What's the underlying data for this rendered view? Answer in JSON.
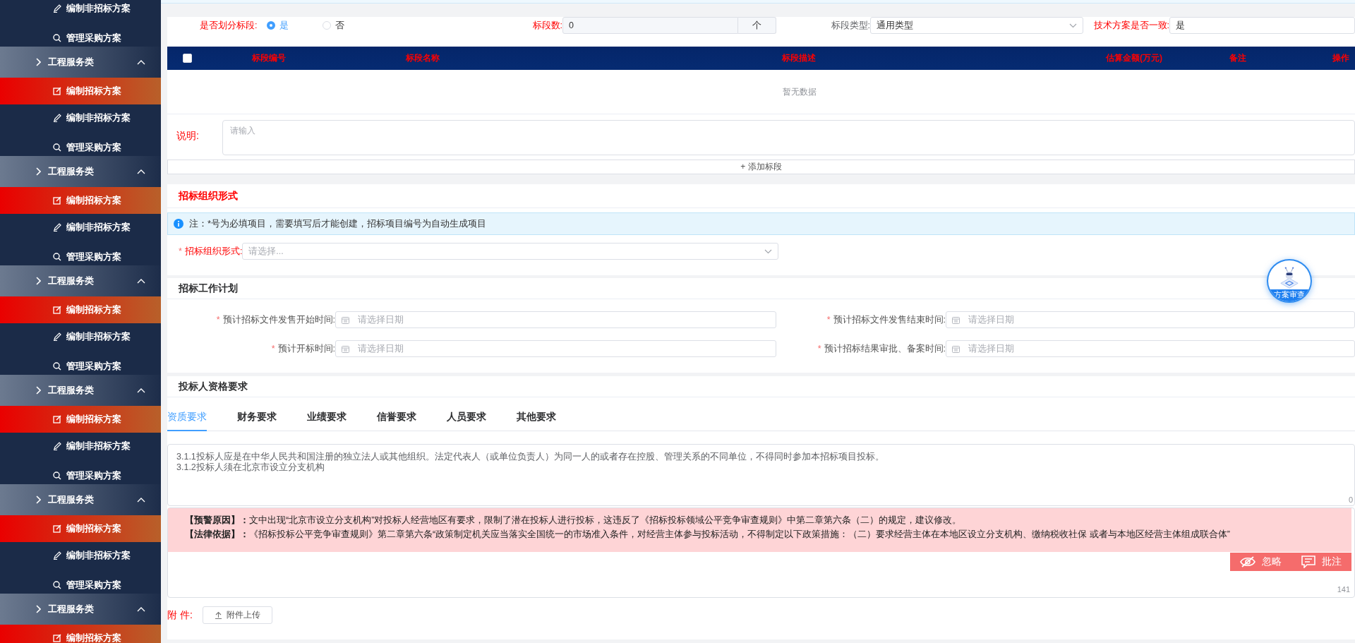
{
  "sidebar": {
    "items": [
      {
        "kind": "item",
        "label": "编制非招标方案",
        "selected": false
      },
      {
        "kind": "item",
        "label": "管理采购方案",
        "selected": false
      },
      {
        "kind": "group",
        "label": "工程服务类",
        "expanded": true
      },
      {
        "kind": "item",
        "label": "编制招标方案",
        "selected": true
      },
      {
        "kind": "item",
        "label": "编制非招标方案",
        "selected": false
      },
      {
        "kind": "item",
        "label": "管理采购方案",
        "selected": false
      },
      {
        "kind": "group",
        "label": "工程服务类",
        "expanded": true
      },
      {
        "kind": "item",
        "label": "编制招标方案",
        "selected": true
      },
      {
        "kind": "item",
        "label": "编制非招标方案",
        "selected": false
      },
      {
        "kind": "item",
        "label": "管理采购方案",
        "selected": false
      },
      {
        "kind": "group",
        "label": "工程服务类",
        "expanded": true
      },
      {
        "kind": "item",
        "label": "编制招标方案",
        "selected": true
      },
      {
        "kind": "item",
        "label": "编制非招标方案",
        "selected": false
      },
      {
        "kind": "item",
        "label": "管理采购方案",
        "selected": false
      },
      {
        "kind": "group",
        "label": "工程服务类",
        "expanded": true
      },
      {
        "kind": "item",
        "label": "编制招标方案",
        "selected": true
      },
      {
        "kind": "item",
        "label": "编制非招标方案",
        "selected": false
      },
      {
        "kind": "item",
        "label": "管理采购方案",
        "selected": false
      },
      {
        "kind": "group",
        "label": "工程服务类",
        "expanded": true
      },
      {
        "kind": "item",
        "label": "编制招标方案",
        "selected": true
      },
      {
        "kind": "item",
        "label": "编制非招标方案",
        "selected": false
      },
      {
        "kind": "item",
        "label": "管理采购方案",
        "selected": false
      },
      {
        "kind": "group",
        "label": "工程服务类",
        "expanded": true
      },
      {
        "kind": "item",
        "label": "编制招标方案",
        "selected": true
      }
    ]
  },
  "segment_form": {
    "fields": [
      {
        "kind": "radio",
        "label": "是否划分标段:",
        "required": true,
        "options": [
          {
            "label": "是",
            "selected": true
          },
          {
            "label": "否",
            "selected": false
          }
        ]
      },
      {
        "kind": "number",
        "label": "标段数:",
        "required": true,
        "value": "0",
        "unit": "个"
      },
      {
        "kind": "select",
        "label": "标段类型:",
        "required": false,
        "value": "通用类型"
      },
      {
        "kind": "text",
        "label": "技术方案是否一致:",
        "required": true,
        "value": "是"
      }
    ]
  },
  "table": {
    "select_all_checked": false,
    "columns": [
      "标段编号",
      "标段名称",
      "标段描述",
      "估算金额(万元)",
      "备注",
      "操作"
    ],
    "empty_text": "暂无数据"
  },
  "note": {
    "label": "说明:",
    "placeholder": "请输入"
  },
  "add_button": "+ 添加标段",
  "org_section": {
    "title": "招标组织形式",
    "alert": "注：*号为必填项目，需要填写后才能创建，招标项目编号为自动生成项目",
    "field": {
      "required_mark": "*",
      "label": "招标组织形式:",
      "placeholder": "请选择..."
    }
  },
  "plan_section": {
    "title": "招标工作计划",
    "fields": [
      {
        "required_mark": "*",
        "label": "预计招标文件发售开始时间:",
        "placeholder": "请选择日期"
      },
      {
        "required_mark": "*",
        "label": "预计招标文件发售结束时间:",
        "placeholder": "请选择日期"
      },
      {
        "required_mark": "*",
        "label": "预计开标时间:",
        "placeholder": "请选择日期"
      },
      {
        "required_mark": "*",
        "label": "预计招标结果审批、备案时间:",
        "placeholder": "请选择日期"
      }
    ]
  },
  "review_badge": {
    "label": "方案审查"
  },
  "qualification": {
    "title": "投标人资格要求",
    "tabs": [
      {
        "label": "资质要求",
        "selected": true
      },
      {
        "label": "财务要求",
        "selected": false
      },
      {
        "label": "业绩要求",
        "selected": false
      },
      {
        "label": "信誉要求",
        "selected": false
      },
      {
        "label": "人员要求",
        "selected": false
      },
      {
        "label": "其他要求",
        "selected": false
      }
    ],
    "content_lines": [
      "3.1.1投标人应是在中华人民共和国注册的独立法人或其他组织。法定代表人（或单位负责人）为同一人的或者存在控股、管理关系的不同单位，不得同时参加本招标项目投标。",
      "3.1.2投标人须在北京市设立分支机构"
    ],
    "content_counter": "0",
    "warning_lines": [
      "**【预警原因】：**文中出现“北京市设立分支机构”对投标人经营地区有要求，限制了潜在投标人进行投标，这违反了《招标投标领域公平竞争审查规则》中第二章第六条（二）的规定，建议修改。",
      "**【法律依据】：**《招标投标公平竞争审查规则》第二章第六条“政策制定机关应当落实全国统一的市场准入条件，对经营主体参与投标活动，不得制定以下政策措施：（二）要求经营主体在本地区设立分支机构、缴纳税收社保 或者与本地区经营主体组成联合体”"
    ],
    "actions": [
      {
        "kind": "ignore",
        "label": "忽略"
      },
      {
        "kind": "comment",
        "label": "批注"
      }
    ],
    "warning_counter": "141"
  },
  "attachment": {
    "label": "附 件:",
    "button": "附件上传"
  }
}
